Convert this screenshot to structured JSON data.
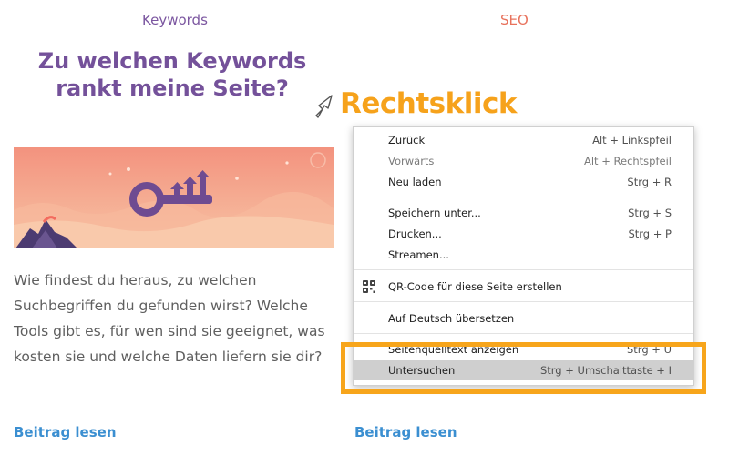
{
  "categories": {
    "left": "Keywords",
    "right": "SEO"
  },
  "article_left": {
    "title": "Zu welchen Keywords rankt meine Seite?",
    "excerpt": "Wie findest du heraus, zu welchen Suchbegriffen du gefunden wirst? Welche Tools gibt es, für wen sind sie geeignet, was kosten sie und welche Daten liefern sie dir?",
    "read_more": "Beitrag lesen"
  },
  "article_right": {
    "read_more": "Beitrag lesen"
  },
  "annotation": {
    "label": "Rechtsklick",
    "color": "#f6a21b"
  },
  "context_menu": {
    "items": [
      {
        "label": "Zurück",
        "shortcut": "Alt + Linkspfeil"
      },
      {
        "label": "Vorwärts",
        "shortcut": "Alt + Rechtspfeil",
        "disabled": true
      },
      {
        "label": "Neu laden",
        "shortcut": "Strg + R"
      },
      {
        "label": "Speichern unter...",
        "shortcut": "Strg + S"
      },
      {
        "label": "Drucken...",
        "shortcut": "Strg + P"
      },
      {
        "label": "Streamen...",
        "shortcut": ""
      },
      {
        "label": "QR-Code für diese Seite erstellen",
        "shortcut": "",
        "icon": "qr-code-icon"
      },
      {
        "label": "Auf Deutsch übersetzen",
        "shortcut": ""
      },
      {
        "label": "Seitenquelltext anzeigen",
        "shortcut": "Strg + U"
      },
      {
        "label": "Untersuchen",
        "shortcut": "Strg + Umschalttaste + I",
        "highlighted": true
      }
    ]
  },
  "colors": {
    "brand_purple": "#74519a",
    "link_blue": "#3b8fd1",
    "highlight_orange": "#f7a51b"
  }
}
